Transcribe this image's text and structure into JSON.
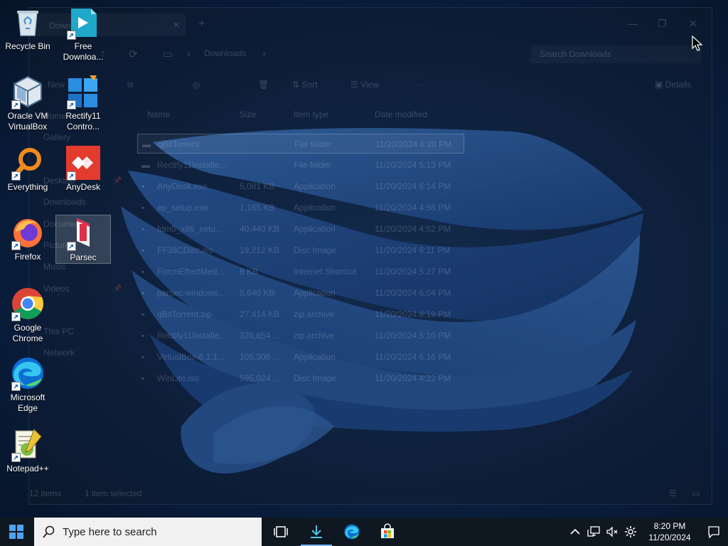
{
  "explorer": {
    "tab_title": "Downloads",
    "address_location": "Downloads",
    "search_placeholder": "Search Downloads",
    "toolbar": {
      "new_label": "New",
      "sort_label": "Sort",
      "view_label": "View",
      "more_label": "···",
      "details_label": "Details"
    },
    "sidebar": [
      "Home",
      "Gallery",
      "Desktop",
      "Downloads",
      "Documents",
      "Pictures",
      "Music",
      "Videos",
      "This PC",
      "Network"
    ],
    "columns": {
      "name": "Name",
      "size": "Size",
      "type": "Item type",
      "date": "Date modified"
    },
    "files": [
      {
        "name": "qBitTorrent",
        "size": "",
        "type": "File folder",
        "date": "11/20/2024 8:20 PM"
      },
      {
        "name": "Rectify11Installe...",
        "size": "",
        "type": "File folder",
        "date": "11/20/2024 5:13 PM"
      },
      {
        "name": "AnyDesk.exe",
        "size": "5,081 KB",
        "type": "Application",
        "date": "11/20/2024 6:14 PM"
      },
      {
        "name": "ep_setup.exe",
        "size": "1,185 KB",
        "type": "Application",
        "date": "11/20/2024 4:56 PM"
      },
      {
        "name": "fdm5_x86_setu...",
        "size": "40,440 KB",
        "type": "Application",
        "date": "11/20/2024 4:52 PM"
      },
      {
        "name": "FF38CDisc.iso",
        "size": "19,212 KB",
        "type": "Disc Image",
        "date": "11/20/2024 6:11 PM"
      },
      {
        "name": "ForceEffectMed...",
        "size": "8 KB",
        "type": "Internet Shortcut",
        "date": "11/20/2024 5:27 PM"
      },
      {
        "name": "parsec-windows...",
        "size": "5,640 KB",
        "type": "Application",
        "date": "11/20/2024 6:04 PM"
      },
      {
        "name": "qBitTorrent.zip",
        "size": "27,414 KB",
        "type": "zip archive",
        "date": "11/20/2024 8:19 PM"
      },
      {
        "name": "Rectify11Installe...",
        "size": "370,654 ...",
        "type": "zip archive",
        "date": "11/20/2024 5:10 PM"
      },
      {
        "name": "VirtualBox-6.1.1...",
        "size": "105,306 ...",
        "type": "Application",
        "date": "11/20/2024 6:16 PM"
      },
      {
        "name": "WinLite.iso",
        "size": "595,024 ...",
        "type": "Disc Image",
        "date": "11/20/2024 4:22 PM"
      }
    ],
    "status": {
      "count": "12 items",
      "selected": "1 item selected"
    }
  },
  "desktop_icons": [
    {
      "label": "Recycle Bin",
      "icon": "recycle-bin-icon"
    },
    {
      "label": "Free Downloa...",
      "icon": "free-download-manager-icon"
    },
    {
      "label": "Oracle VM VirtualBox",
      "icon": "virtualbox-icon"
    },
    {
      "label": "Rectify11 Contro...",
      "icon": "rectify11-icon"
    },
    {
      "label": "Everything",
      "icon": "everything-icon"
    },
    {
      "label": "AnyDesk",
      "icon": "anydesk-icon"
    },
    {
      "label": "Firefox",
      "icon": "firefox-icon"
    },
    {
      "label": "Parsec",
      "icon": "parsec-icon"
    },
    {
      "label": "Google Chrome",
      "icon": "chrome-icon"
    },
    {
      "label": "Microsoft Edge",
      "icon": "edge-icon"
    },
    {
      "label": "Notepad++",
      "icon": "notepad-plus-plus-icon"
    }
  ],
  "taskbar": {
    "search_placeholder": "Type here to search",
    "pinned": [
      "task-view-icon",
      "download-manager-icon",
      "edge-icon",
      "microsoft-store-icon"
    ],
    "tray": [
      "chevron-up-icon",
      "network-icon",
      "volume-muted-icon",
      "settings-gear-icon"
    ],
    "time": "8:20 PM",
    "date": "11/20/2024"
  },
  "colors": {
    "taskbar": "#0f1720",
    "search_box": "#f1f1f1",
    "active_indicator": "#7ab7ff",
    "wallpaper": "#0c2547",
    "bloom": "#2f68b8"
  }
}
